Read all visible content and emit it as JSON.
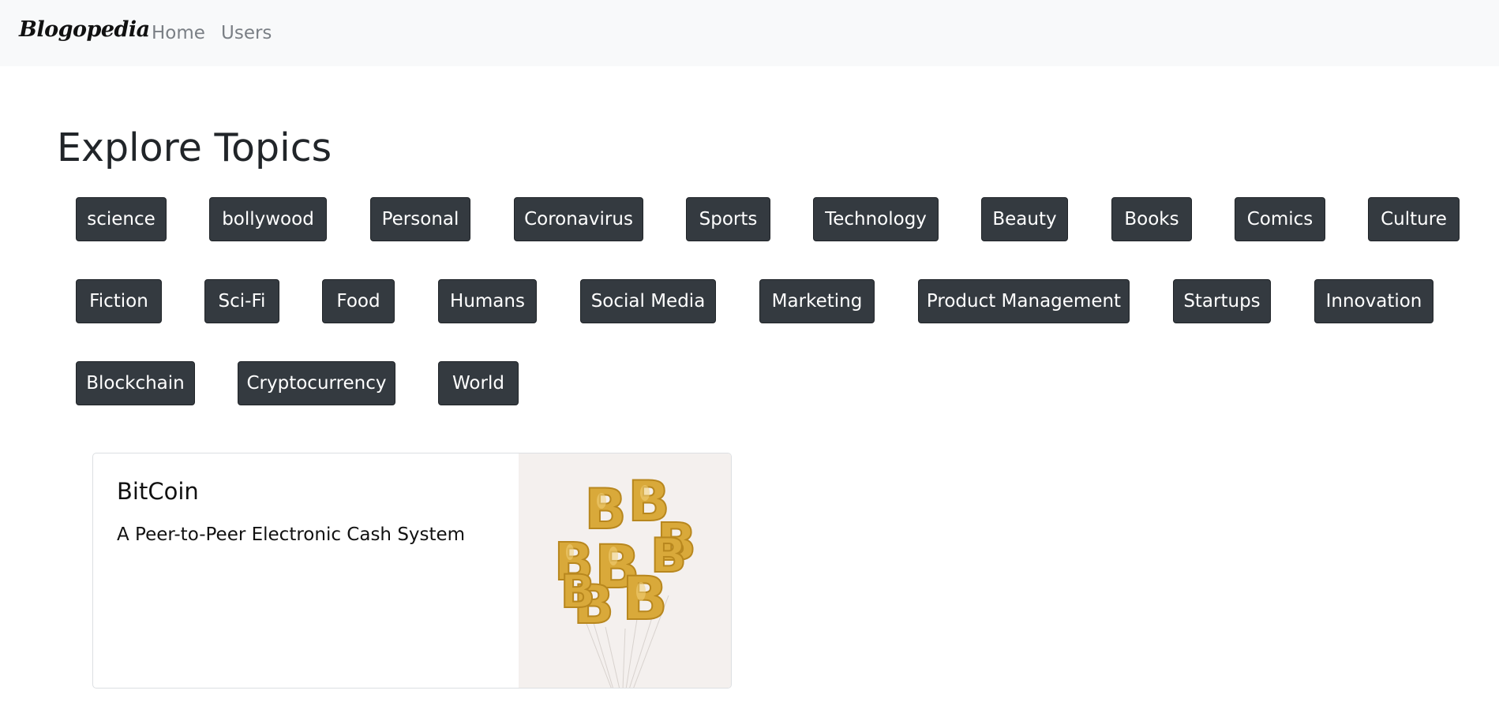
{
  "navbar": {
    "brand": "Blogopedia",
    "links": [
      "Home",
      "Users"
    ]
  },
  "page": {
    "title": "Explore Topics"
  },
  "topics": [
    "science",
    "bollywood",
    "Personal",
    "Coronavirus",
    "Sports",
    "Technology",
    "Beauty",
    "Books",
    "Comics",
    "Culture",
    "Fiction",
    "Sci-Fi",
    "Food",
    "Humans",
    "Social Media",
    "Marketing",
    "Product Management",
    "Startups",
    "Innovation",
    "Blockchain",
    "Cryptocurrency",
    "World"
  ],
  "card": {
    "title": "BitCoin",
    "text": "A Peer-to-Peer Electronic Cash System",
    "image_icon": "gold-bitcoin-balloons-image"
  },
  "colors": {
    "navbar_bg": "#f8f9fa",
    "topic_bg": "#343a40",
    "balloon_gold": "#d9a93a"
  }
}
